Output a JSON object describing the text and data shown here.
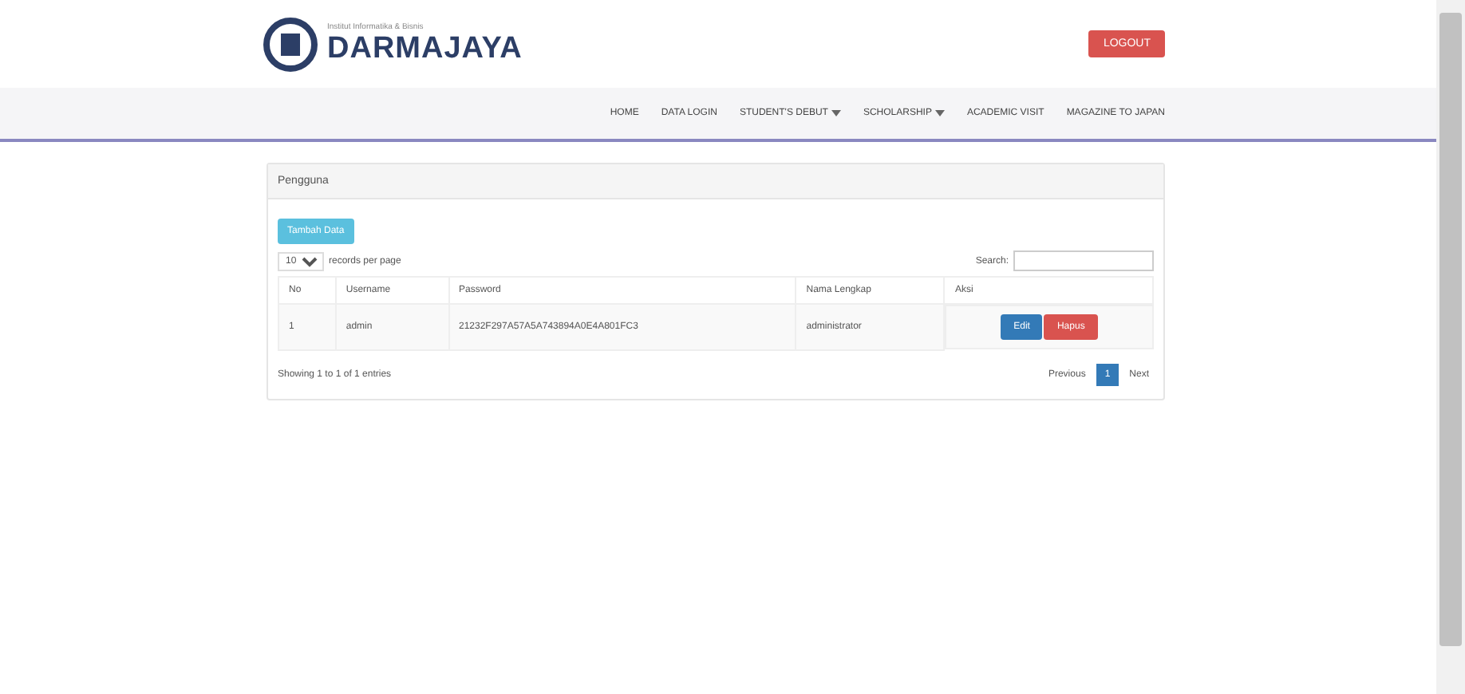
{
  "header": {
    "brand": "DARMAJAYA",
    "tagline": "Institut Informatika & Bisnis",
    "logout": "LOGOUT"
  },
  "nav": [
    {
      "label": "HOME",
      "dropdown": false
    },
    {
      "label": "DATA LOGIN",
      "dropdown": false
    },
    {
      "label": "STUDENT'S DEBUT",
      "dropdown": true
    },
    {
      "label": "SCHOLARSHIP",
      "dropdown": true
    },
    {
      "label": "ACADEMIC VISIT",
      "dropdown": false
    },
    {
      "label": "MAGAZINE TO JAPAN",
      "dropdown": false
    }
  ],
  "panel": {
    "title": "Pengguna",
    "add_button": "Tambah Data",
    "page_size": "10",
    "page_size_label": "records per page",
    "search_label": "Search:",
    "table": {
      "columns": [
        "No",
        "Username",
        "Password",
        "Nama Lengkap",
        "Aksi"
      ],
      "rows": [
        {
          "cells": [
            "1",
            "admin",
            "21232F297A57A5A743894A0E4A801FC3",
            "administrator"
          ],
          "actions": [
            "Edit",
            "Hapus"
          ]
        }
      ]
    },
    "info": "Showing 1 to 1 of 1 entries",
    "pagination": [
      {
        "label": "Previous",
        "selected": false
      },
      {
        "label": "1",
        "selected": true
      },
      {
        "label": "Next",
        "selected": false
      }
    ]
  }
}
